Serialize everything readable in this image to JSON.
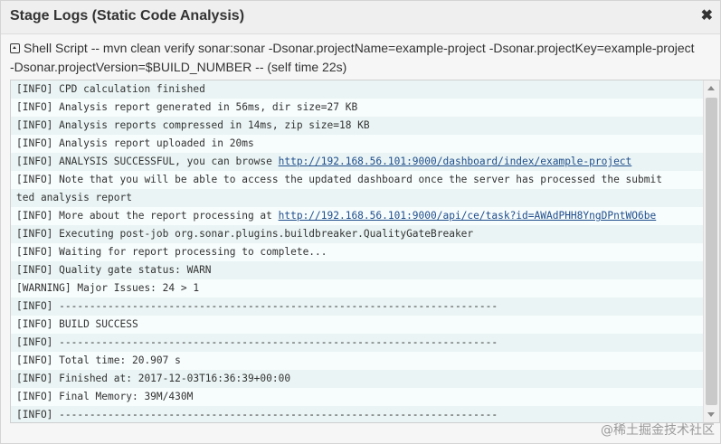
{
  "dialog": {
    "title": "Stage Logs (Static Code Analysis)",
    "close_glyph": "✖",
    "command_line1": "Shell Script -- mvn clean verify sonar:sonar -Dsonar.projectName=example-project -Dsonar.projectKey=example-project",
    "command_line2": "-Dsonar.projectVersion=$BUILD_NUMBER -- (self time 22s)"
  },
  "log": {
    "lines": [
      {
        "text": "[INFO] CPD calculation finished"
      },
      {
        "text": "[INFO] Analysis report generated in 56ms, dir size=27 KB"
      },
      {
        "text": "[INFO] Analysis reports compressed in 14ms, zip size=18 KB"
      },
      {
        "text": "[INFO] Analysis report uploaded in 20ms"
      },
      {
        "text": "[INFO] ANALYSIS SUCCESSFUL, you can browse ",
        "link": "http://192.168.56.101:9000/dashboard/index/example-project"
      },
      {
        "text": "[INFO] Note that you will be able to access the updated dashboard once the server has processed the submit"
      },
      {
        "text": "ted analysis report"
      },
      {
        "text": "[INFO] More about the report processing at ",
        "link": "http://192.168.56.101:9000/api/ce/task?id=AWAdPHH8YngDPntWO6be"
      },
      {
        "text": "[INFO] Executing post-job org.sonar.plugins.buildbreaker.QualityGateBreaker"
      },
      {
        "text": "[INFO] Waiting for report processing to complete..."
      },
      {
        "text": "[INFO] Quality gate status: WARN"
      },
      {
        "text": "[WARNING] Major Issues: 24 > 1"
      },
      {
        "text": "[INFO] ------------------------------------------------------------------------"
      },
      {
        "text": "[INFO] BUILD SUCCESS"
      },
      {
        "text": "[INFO] ------------------------------------------------------------------------"
      },
      {
        "text": "[INFO] Total time: 20.907 s"
      },
      {
        "text": "[INFO] Finished at: 2017-12-03T16:36:39+00:00"
      },
      {
        "text": "[INFO] Final Memory: 39M/430M"
      },
      {
        "text": "[INFO] ------------------------------------------------------------------------"
      }
    ]
  },
  "watermark": "@稀土掘金技术社区"
}
